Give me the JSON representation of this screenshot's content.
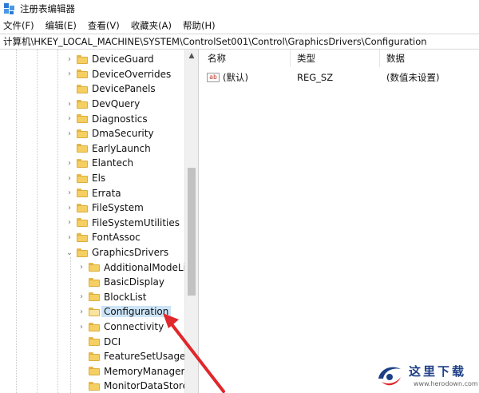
{
  "window": {
    "title": "注册表编辑器",
    "app_icon": "registry-editor-icon"
  },
  "menu": {
    "items": [
      "文件(F)",
      "编辑(E)",
      "查看(V)",
      "收藏夹(A)",
      "帮助(H)"
    ]
  },
  "address": {
    "path": "计算机\\HKEY_LOCAL_MACHINE\\SYSTEM\\ControlSet001\\Control\\GraphicsDrivers\\Configuration"
  },
  "tree": {
    "items": [
      {
        "label": "DeviceGuard",
        "level": 0,
        "expandable": true,
        "expanded": false
      },
      {
        "label": "DeviceOverrides",
        "level": 0,
        "expandable": true,
        "expanded": false
      },
      {
        "label": "DevicePanels",
        "level": 0,
        "expandable": false,
        "expanded": false
      },
      {
        "label": "DevQuery",
        "level": 0,
        "expandable": true,
        "expanded": false
      },
      {
        "label": "Diagnostics",
        "level": 0,
        "expandable": true,
        "expanded": false
      },
      {
        "label": "DmaSecurity",
        "level": 0,
        "expandable": true,
        "expanded": false
      },
      {
        "label": "EarlyLaunch",
        "level": 0,
        "expandable": false,
        "expanded": false
      },
      {
        "label": "Elantech",
        "level": 0,
        "expandable": true,
        "expanded": false
      },
      {
        "label": "Els",
        "level": 0,
        "expandable": true,
        "expanded": false
      },
      {
        "label": "Errata",
        "level": 0,
        "expandable": true,
        "expanded": false
      },
      {
        "label": "FileSystem",
        "level": 0,
        "expandable": true,
        "expanded": false
      },
      {
        "label": "FileSystemUtilities",
        "level": 0,
        "expandable": true,
        "expanded": false
      },
      {
        "label": "FontAssoc",
        "level": 0,
        "expandable": true,
        "expanded": false
      },
      {
        "label": "GraphicsDrivers",
        "level": 0,
        "expandable": true,
        "expanded": true
      },
      {
        "label": "AdditionalModeList",
        "level": 1,
        "expandable": true,
        "expanded": false
      },
      {
        "label": "BasicDisplay",
        "level": 1,
        "expandable": false,
        "expanded": false
      },
      {
        "label": "BlockList",
        "level": 1,
        "expandable": true,
        "expanded": false
      },
      {
        "label": "Configuration",
        "level": 1,
        "expandable": true,
        "expanded": false,
        "selected": true
      },
      {
        "label": "Connectivity",
        "level": 1,
        "expandable": true,
        "expanded": false
      },
      {
        "label": "DCI",
        "level": 1,
        "expandable": false,
        "expanded": false
      },
      {
        "label": "FeatureSetUsage",
        "level": 1,
        "expandable": false,
        "expanded": false
      },
      {
        "label": "MemoryManager",
        "level": 1,
        "expandable": false,
        "expanded": false
      },
      {
        "label": "MonitorDataStore",
        "level": 1,
        "expandable": false,
        "expanded": false
      }
    ]
  },
  "list": {
    "columns": [
      "名称",
      "类型",
      "数据"
    ],
    "rows": [
      {
        "icon": "ab",
        "name": "(默认)",
        "type": "REG_SZ",
        "data": "(数值未设置)"
      }
    ]
  },
  "watermark": {
    "text": "这里下载",
    "url": "www.herodown.com"
  },
  "colors": {
    "selection": "#cce4f7",
    "folder": "#f5cf62",
    "arrow": "#e0272b",
    "watermark": "#1d3f86"
  }
}
